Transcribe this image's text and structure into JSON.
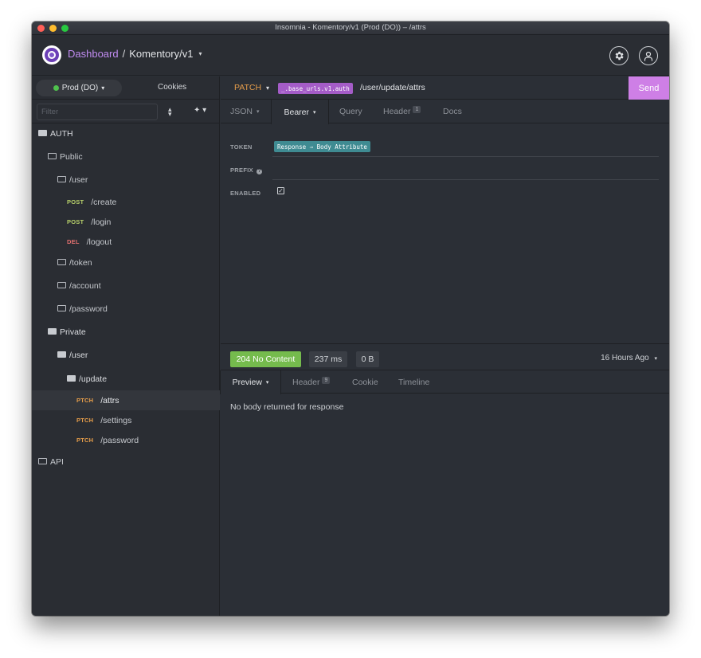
{
  "window": {
    "title": "Insomnia - Komentory/v1 (Prod (DO)) – /attrs"
  },
  "header": {
    "dashboard_label": "Dashboard",
    "separator": "/",
    "workspace_label": "Komentory/v1",
    "caret": "▾"
  },
  "sidebar": {
    "environment_label": "Prod (DO)",
    "environment_caret": "▾",
    "environment_color": "#4fc24d",
    "cookies_label": "Cookies",
    "filter_placeholder": "Filter",
    "plus_label": "✦ ▾",
    "tree": [
      {
        "type": "folder",
        "label": "AUTH",
        "open": true
      },
      {
        "type": "folder",
        "label": "Public",
        "open": false
      },
      {
        "type": "folder",
        "label": "/user",
        "open": false
      },
      {
        "type": "request",
        "method": "POST",
        "label": "/create"
      },
      {
        "type": "request",
        "method": "POST",
        "label": "/login"
      },
      {
        "type": "request",
        "method": "DEL",
        "label": "/logout"
      },
      {
        "type": "folder",
        "label": "/token",
        "open": false
      },
      {
        "type": "folder",
        "label": "/account",
        "open": false
      },
      {
        "type": "folder",
        "label": "/password",
        "open": false
      },
      {
        "type": "folder",
        "label": "Private",
        "open": true
      },
      {
        "type": "folder",
        "label": "/user",
        "open": true
      },
      {
        "type": "folder",
        "label": "/update",
        "open": true
      },
      {
        "type": "request",
        "method": "PTCH",
        "label": "/attrs",
        "active": true
      },
      {
        "type": "request",
        "method": "PTCH",
        "label": "/settings"
      },
      {
        "type": "request",
        "method": "PTCH",
        "label": "/password"
      },
      {
        "type": "folder",
        "label": "API",
        "open": false
      }
    ]
  },
  "request": {
    "method": "PATCH",
    "method_caret": "▾",
    "url_tag": "_.base_urls.v1.auth",
    "url_path": "/user/update/attrs",
    "send_label": "Send",
    "tabs": [
      {
        "label": "JSON",
        "caret": "▾"
      },
      {
        "label": "Bearer",
        "caret": "▾"
      },
      {
        "label": "Query"
      },
      {
        "label": "Header",
        "badge": "1"
      },
      {
        "label": "Docs"
      }
    ],
    "auth": {
      "token_label": "TOKEN",
      "token_value": "Response ⇒ Body Attribute",
      "prefix_label": "PREFIX",
      "prefix_info": "?",
      "enabled_label": "ENABLED",
      "enabled_check": "✓"
    }
  },
  "response": {
    "status": "204 No Content",
    "time": "237 ms",
    "size": "0 B",
    "time_ago": "16 Hours Ago",
    "time_ago_caret": "▾",
    "tabs": [
      {
        "label": "Preview",
        "caret": "▾"
      },
      {
        "label": "Header",
        "badge": "9"
      },
      {
        "label": "Cookie"
      },
      {
        "label": "Timeline"
      }
    ],
    "body_text": "No body returned for response"
  }
}
